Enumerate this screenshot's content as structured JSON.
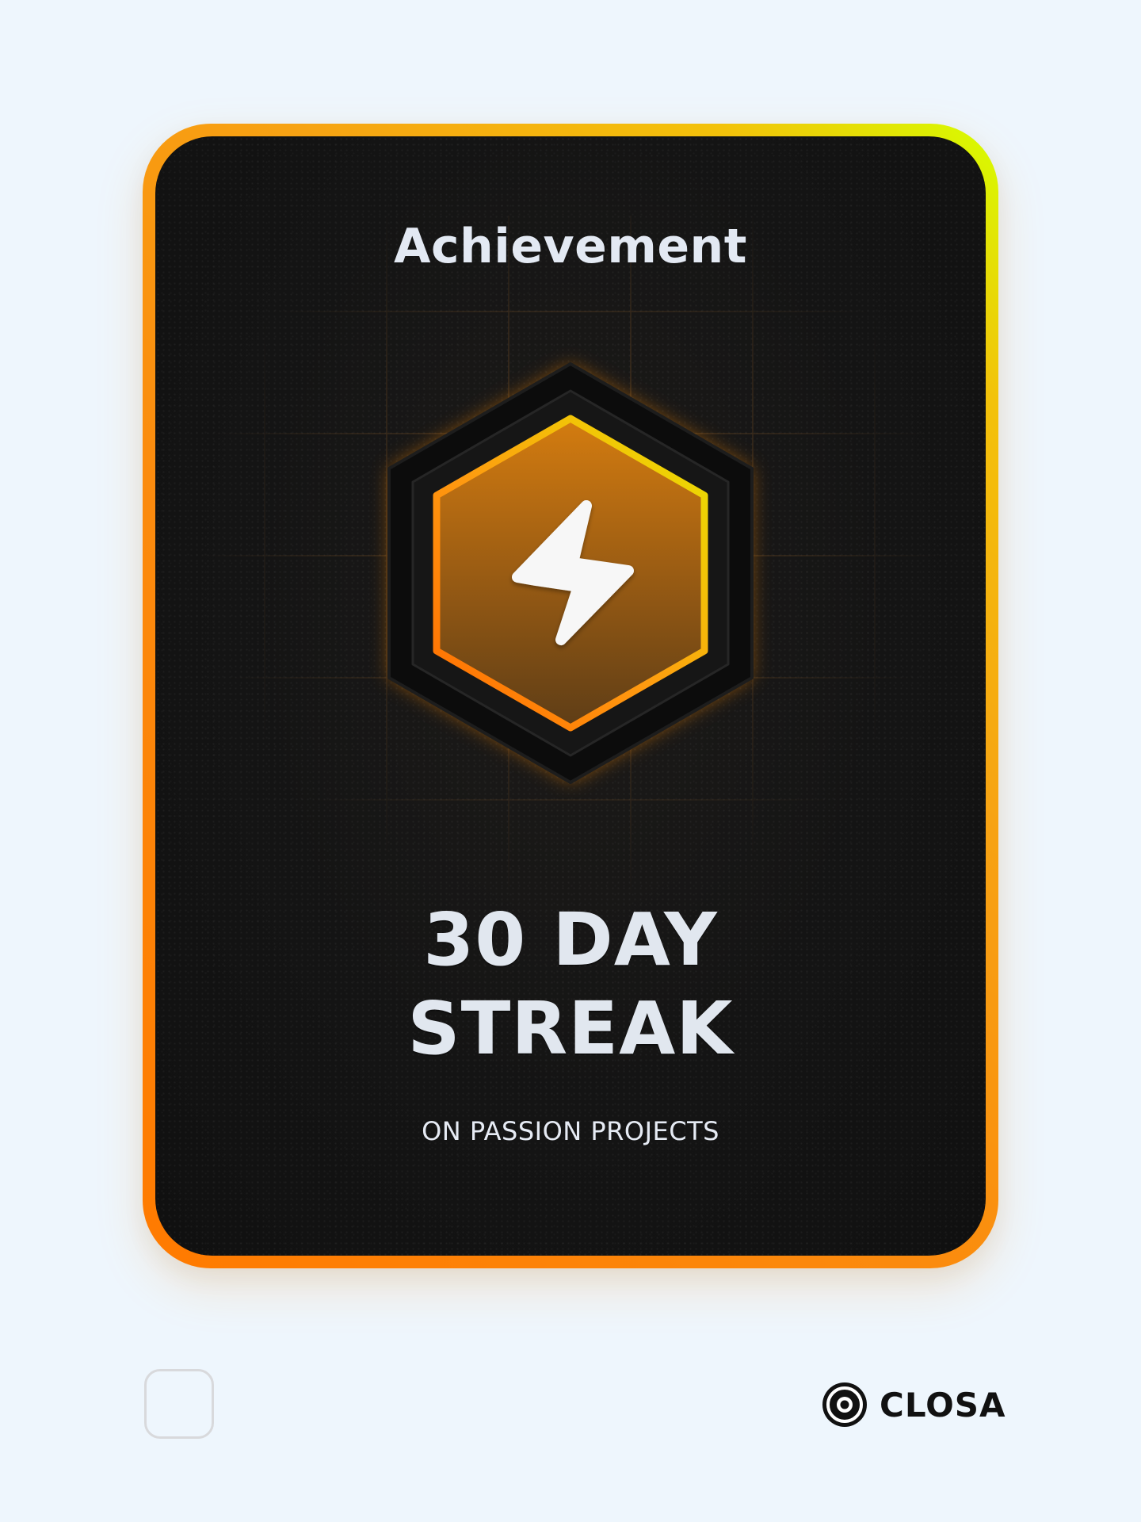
{
  "card": {
    "title": "Achievement",
    "headline_line1": "30 DAY",
    "headline_line2": "STREAK",
    "subtitle": "ON PASSION PROJECTS",
    "badge_icon": "lightning-bolt-icon"
  },
  "footer": {
    "checkbox_checked": false,
    "brand_name": "CLOSA",
    "brand_icon": "closa-logo-icon"
  },
  "colors": {
    "page_background": "#eef6fd",
    "border_gradient_start": "#ff7a00",
    "border_gradient_end": "#d6ff00",
    "card_background": "#141414",
    "badge_top": "#d17a0f",
    "badge_bottom": "#6a4415",
    "text_light": "#e3e9f3"
  }
}
